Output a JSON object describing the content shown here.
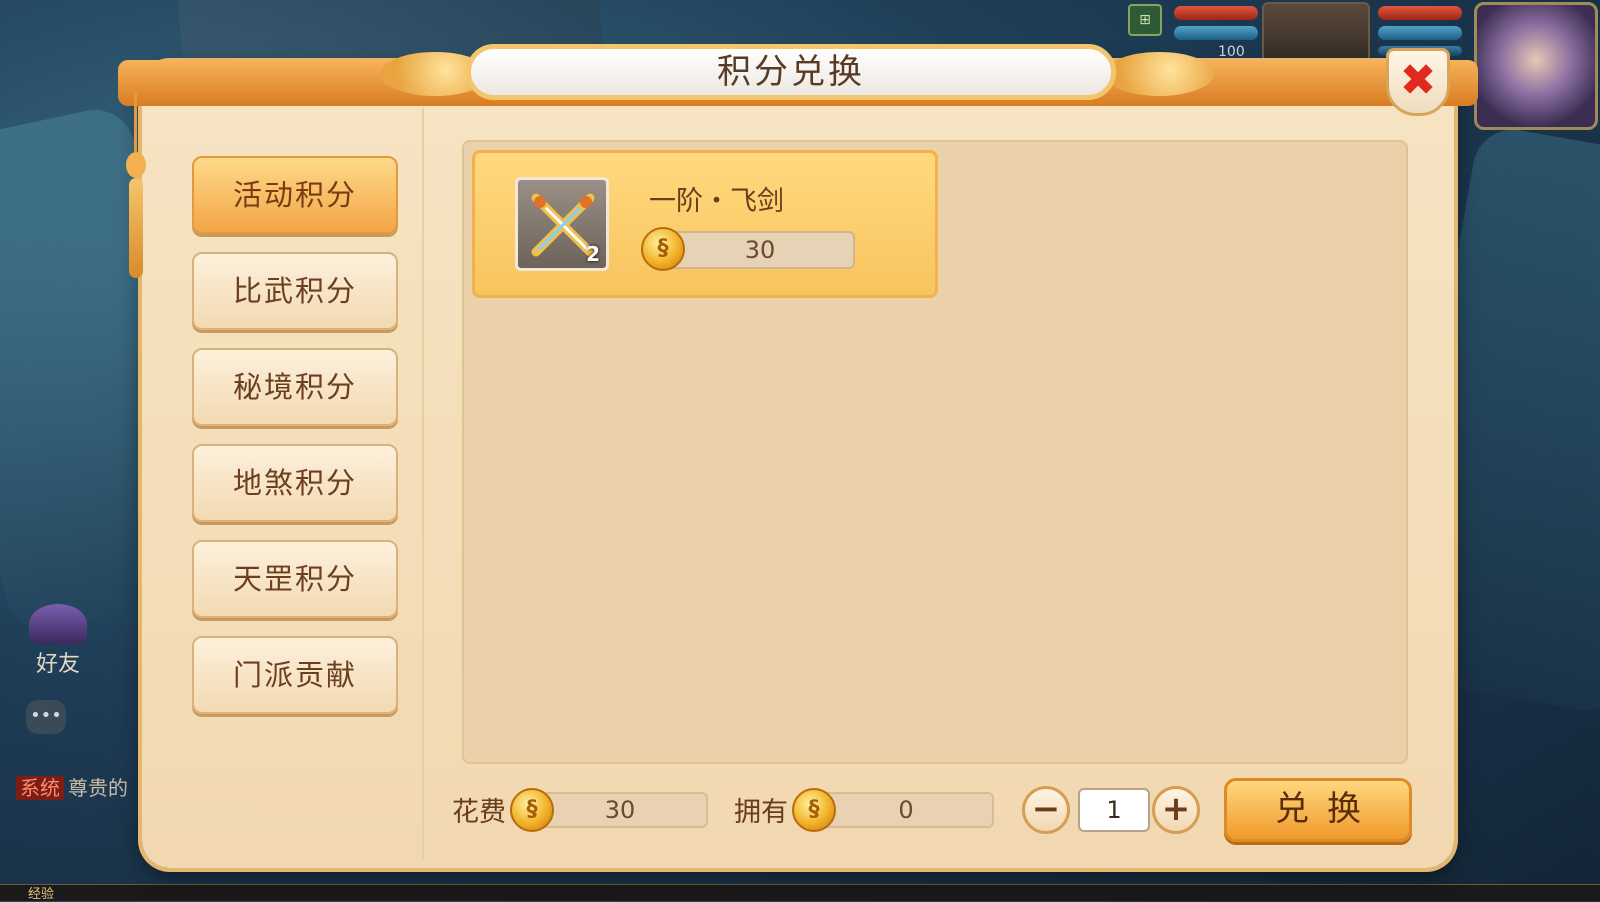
{
  "hud": {
    "level_text": "100",
    "map_icon": "map-icon"
  },
  "side": {
    "friend_label": "好友",
    "system_tag": "系统",
    "system_message": "尊贵的",
    "exp_label": "经验"
  },
  "dialog": {
    "title": "积分兑换",
    "close_glyph": "✖",
    "tabs": [
      {
        "label": "活动积分",
        "active": true
      },
      {
        "label": "比武积分",
        "active": false
      },
      {
        "label": "秘境积分",
        "active": false
      },
      {
        "label": "地煞积分",
        "active": false
      },
      {
        "label": "天罡积分",
        "active": false
      },
      {
        "label": "门派贡献",
        "active": false
      }
    ],
    "items": [
      {
        "name": "一阶・飞剑",
        "price": "30",
        "count": "2",
        "icon": "crossed-swords-icon"
      }
    ],
    "cost_label": "花费",
    "cost_value": "30",
    "own_label": "拥有",
    "own_value": "0",
    "minus_glyph": "−",
    "plus_glyph": "+",
    "quantity": "1",
    "exchange_label": "兑换"
  },
  "colors": {
    "accent": "#f2a546",
    "panel": "#f7e4c3",
    "close": "#e12a1f"
  }
}
